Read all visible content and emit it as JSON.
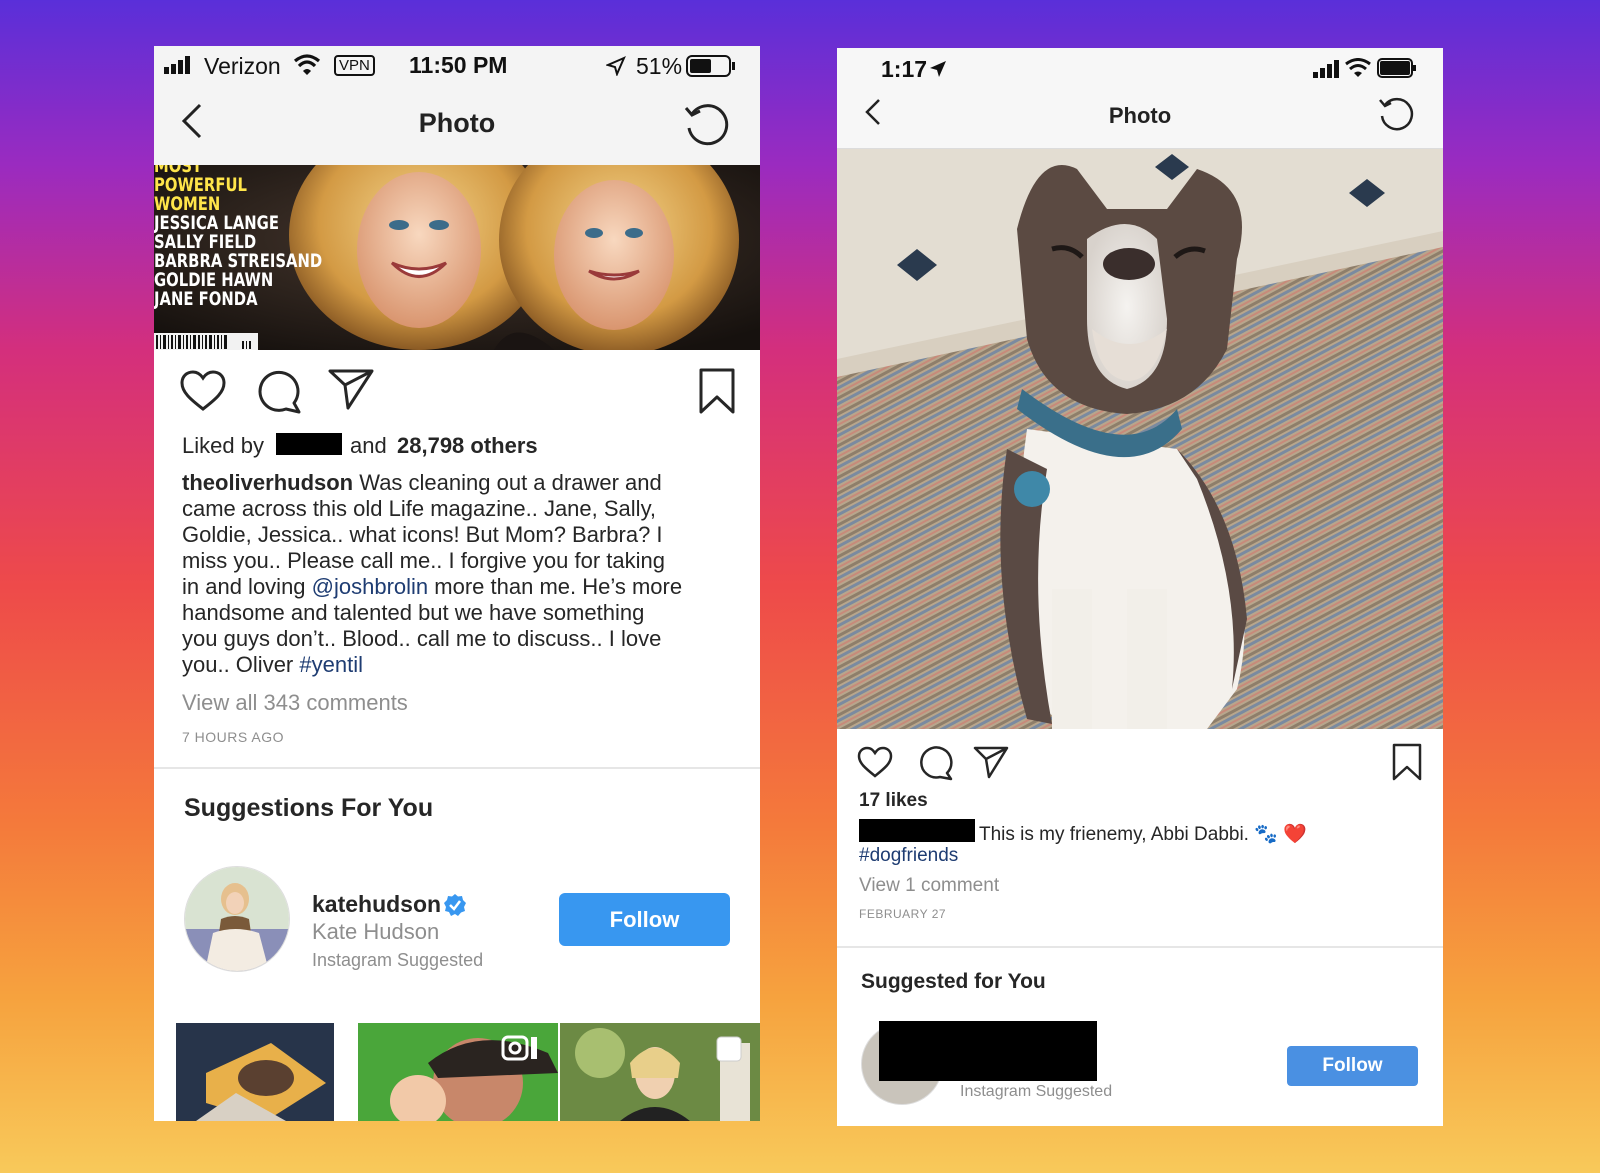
{
  "left": {
    "status": {
      "carrier": "Verizon",
      "vpn": "VPN",
      "time": "11:50 PM",
      "battery": "51%"
    },
    "nav": {
      "title": "Photo"
    },
    "magazine": {
      "lines": [
        "MOST",
        "POWERFUL",
        "WOMEN",
        "JESSICA LANGE",
        "SALLY FIELD",
        "BARBRA STREISAND",
        "GOLDIE HAWN",
        "JANE FONDA"
      ]
    },
    "likes": {
      "prefix": "Liked by",
      "and": "and",
      "count": "28,798 others"
    },
    "caption": {
      "username": "theoliverhudson",
      "l1": "Was cleaning out a drawer and",
      "l2": "came across this old Life magazine.. Jane, Sally,",
      "l3": "Goldie, Jessica.. what icons!  But Mom?  Barbra? I",
      "l4": "miss you.. Please call me.. I forgive you for taking",
      "l5a": "in and loving",
      "mention": "@joshbrolin",
      "l5b": "more than me. He’s more",
      "l6": "handsome and talented but we have something",
      "l7": "you guys don’t.. Blood.. call me to discuss.. I love",
      "l8a": "you.. Oliver",
      "hashtag": "#yentil"
    },
    "view_comments": "View all 343 comments",
    "time_ago": "7 HOURS AGO",
    "suggestions_title": "Suggestions For You",
    "suggestion": {
      "username": "katehudson",
      "name": "Kate Hudson",
      "source": "Instagram Suggested",
      "follow": "Follow"
    }
  },
  "right": {
    "status": {
      "time": "1:17"
    },
    "nav": {
      "title": "Photo"
    },
    "likes": "17 likes",
    "caption": {
      "text": "This is my frienemy, Abbi Dabbi. 🐾 ❤️",
      "hashtag": "#dogfriends"
    },
    "view_comments": "View 1 comment",
    "date": "FEBRUARY 27",
    "suggestions_title": "Suggested for You",
    "suggestion": {
      "source": "Instagram Suggested",
      "follow": "Follow"
    }
  },
  "colors": {
    "follow_blue": "#3897f0",
    "link": "#1e3c72",
    "grey": "#8e8e8e"
  }
}
